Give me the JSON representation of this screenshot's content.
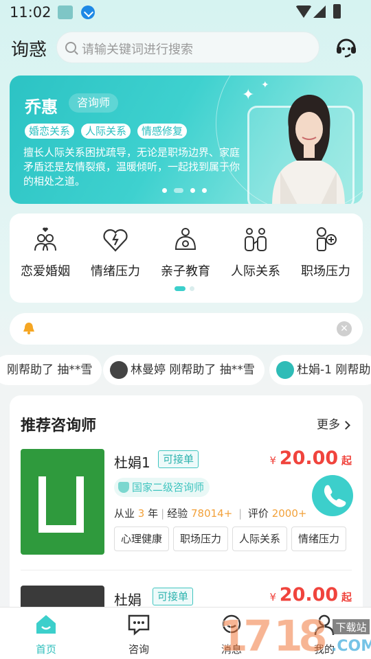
{
  "status_bar": {
    "time": "11:02"
  },
  "header": {
    "title": "询惑",
    "search_placeholder": "请输关键词进行搜索"
  },
  "banner": {
    "name": "乔惠",
    "role": "咨询师",
    "tags": [
      "婚恋关系",
      "人际关系",
      "情感修复"
    ],
    "description": "擅长人际关系困扰疏导，无论是职场边界、家庭矛盾还是友情裂痕，温暖倾听，一起找到属于你的相处之道。"
  },
  "categories": [
    {
      "label": "恋爱婚姻",
      "icon": "couple-heart-icon"
    },
    {
      "label": "情绪压力",
      "icon": "broken-heart-icon"
    },
    {
      "label": "亲子教育",
      "icon": "parent-child-icon"
    },
    {
      "label": "人际关系",
      "icon": "people-icon"
    },
    {
      "label": "职场压力",
      "icon": "worker-plus-icon"
    }
  ],
  "ticker": [
    {
      "text": "刚帮助了 抽**雪"
    },
    {
      "text": "林曼婷 刚帮助了 抽**雪"
    },
    {
      "text": "杜娟-1 刚帮助"
    }
  ],
  "recommend": {
    "title": "推荐咨询师",
    "more": "更多",
    "counselors": [
      {
        "name": "杜娟1",
        "status": "可接单",
        "price_symbol": "¥",
        "price": "20.00",
        "price_unit": "起",
        "cert": "国家二级咨询师",
        "years_label": "从业",
        "years": "3",
        "years_unit": "年",
        "exp_label": "经验",
        "exp": "78014+",
        "rating_label": "评价",
        "rating": "2000+",
        "tags": [
          "心理健康",
          "职场压力",
          "人际关系",
          "情绪压力"
        ]
      },
      {
        "name": "杜娟",
        "status": "可接单",
        "price_symbol": "¥",
        "price": "20.00",
        "price_unit": "起"
      }
    ]
  },
  "tabbar": {
    "tabs": [
      {
        "label": "首页",
        "active": true
      },
      {
        "label": "咨询",
        "active": false
      },
      {
        "label": "消息",
        "active": false
      },
      {
        "label": "我的",
        "active": false
      }
    ]
  },
  "colors": {
    "accent": "#3ccfcb",
    "price": "#f0443d",
    "highlight": "#f2a13a"
  }
}
